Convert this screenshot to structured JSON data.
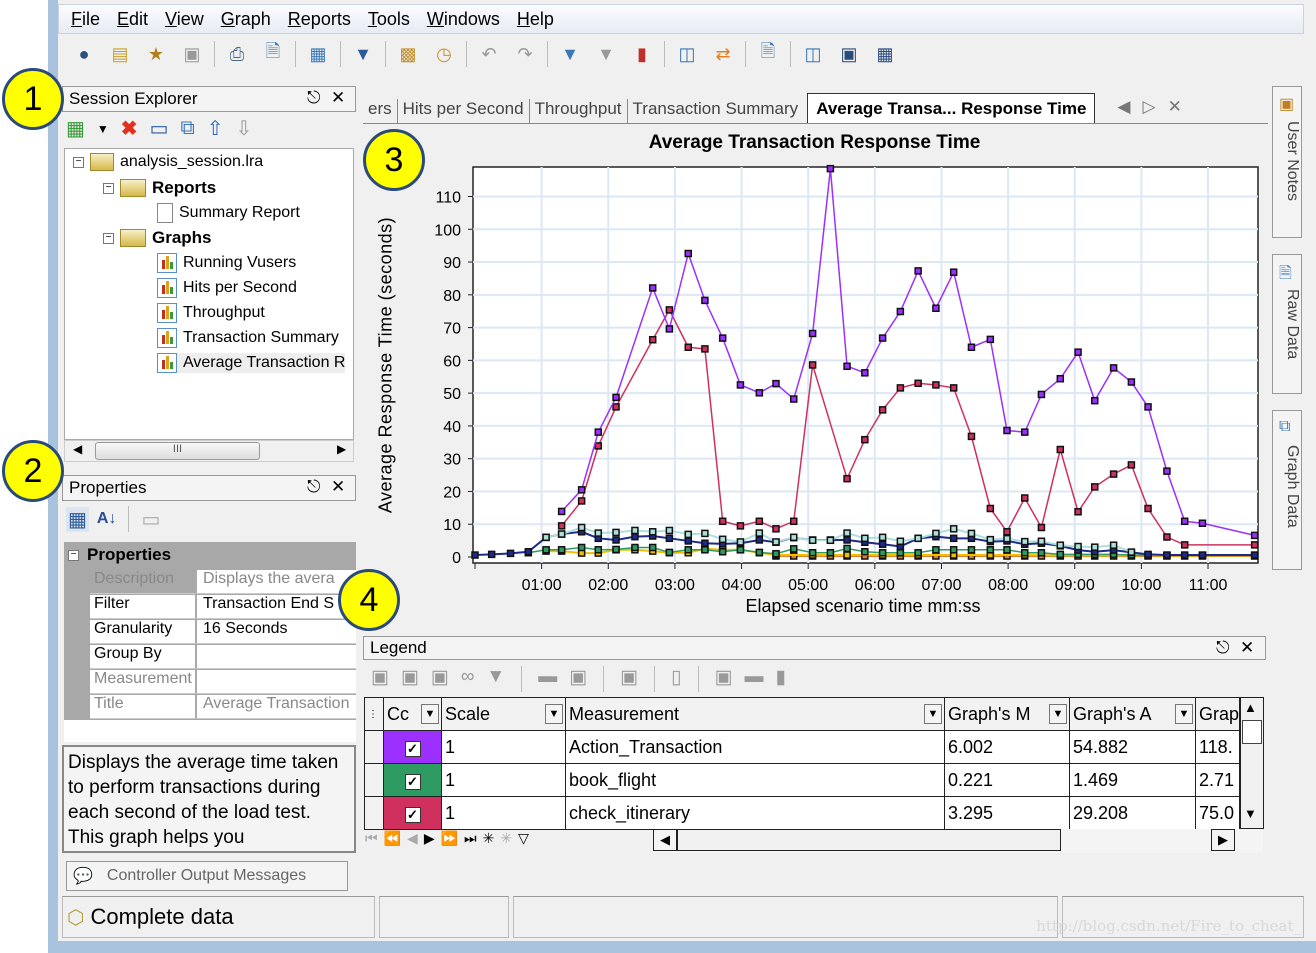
{
  "menu": [
    "File",
    "Edit",
    "View",
    "Graph",
    "Reports",
    "Tools",
    "Windows",
    "Help"
  ],
  "toolbar_icons": [
    "open-session-icon",
    "import-icon",
    "new-session-icon",
    "save-icon",
    "print-icon",
    "export-icon",
    "template-icon",
    "filter-icon",
    "report-icon",
    "schedule-icon",
    "undo-icon",
    "redo-icon",
    "graph-filter-icon",
    "clear-filter-icon",
    "merge-graphs-icon",
    "compare-icon",
    "sync-icon",
    "html-report-icon",
    "properties-icon",
    "zoom-icon",
    "data-icon"
  ],
  "session_explorer": {
    "title": "Session Explorer",
    "tree": {
      "root": "analysis_session.lra",
      "reports_folder": "Reports",
      "summary_report": "Summary Report",
      "graphs_folder": "Graphs",
      "graphs": [
        "Running Vusers",
        "Hits per Second",
        "Throughput",
        "Transaction Summary",
        "Average Transaction R"
      ]
    },
    "scroll_thumb": "III"
  },
  "properties": {
    "title": "Properties",
    "section": "Properties",
    "rows": [
      {
        "key": "Description",
        "value": "Displays the avera"
      },
      {
        "key": "Filter",
        "value": "Transaction End S"
      },
      {
        "key": "Granularity",
        "value": "16 Seconds"
      },
      {
        "key": "Group By",
        "value": ""
      },
      {
        "key": "Measurement",
        "value": ""
      },
      {
        "key": "Title",
        "value": "Average Transaction"
      }
    ],
    "description_text": "Displays the average time taken to perform transactions during each second of the load test. This graph helps you"
  },
  "controller_tab": "Controller Output Messages",
  "status": {
    "text": "Complete data"
  },
  "tabs": [
    "ers",
    "Hits per Second",
    "Throughput",
    "Transaction Summary",
    "Average Transa... Response Time"
  ],
  "side_tabs": [
    "User Notes",
    "Raw Data",
    "Graph Data"
  ],
  "callouts": [
    "1",
    "2",
    "3",
    "4"
  ],
  "watermark": "http://blog.csdn.net/Fire_to_cheat_",
  "legend": {
    "title": "Legend",
    "columns": [
      "Cc",
      "Scale",
      "Measurement",
      "Graph's M",
      "Graph's A",
      "Grap"
    ],
    "rows": [
      {
        "color": "#9b30ff",
        "checked": true,
        "scale": "1",
        "measurement": "Action_Transaction",
        "min": "6.002",
        "avg": "54.882",
        "max": "118."
      },
      {
        "color": "#2e9b62",
        "checked": true,
        "scale": "1",
        "measurement": "book_flight",
        "min": "0.221",
        "avg": "1.469",
        "max": "2.71"
      },
      {
        "color": "#d0305e",
        "checked": true,
        "scale": "1",
        "measurement": "check_itinerary",
        "min": "3.295",
        "avg": "29.208",
        "max": "75.0"
      }
    ]
  },
  "chart_data": {
    "type": "line",
    "title": "Average Transaction Response Time",
    "xlabel": "Elapsed scenario time mm:ss",
    "ylabel": "Average Response Time (seconds)",
    "xlim": [
      "00:00",
      "11:45"
    ],
    "ylim": [
      0,
      119
    ],
    "grid": true,
    "x_ticks": [
      "01:00",
      "02:00",
      "03:00",
      "04:00",
      "05:00",
      "06:00",
      "07:00",
      "08:00",
      "09:00",
      "10:00",
      "11:00"
    ],
    "y_ticks": [
      0,
      10,
      20,
      30,
      40,
      50,
      60,
      70,
      80,
      90,
      100,
      110
    ],
    "series": [
      {
        "name": "Action_Transaction",
        "color": "#9b30ff",
        "points": [
          [
            "01:18",
            13.9
          ],
          [
            "01:36",
            20.5
          ],
          [
            "01:51",
            38.1
          ],
          [
            "02:07",
            48.7
          ],
          [
            "02:40",
            82.1
          ],
          [
            "02:55",
            69.6
          ],
          [
            "03:12",
            92.6
          ],
          [
            "03:27",
            78.3
          ],
          [
            "03:43",
            66.8
          ],
          [
            "03:59",
            52.5
          ],
          [
            "04:16",
            50.1
          ],
          [
            "04:31",
            52.9
          ],
          [
            "04:47",
            48.2
          ],
          [
            "05:04",
            68.2
          ],
          [
            "05:20",
            118.5
          ],
          [
            "05:35",
            58.2
          ],
          [
            "05:51",
            56.2
          ],
          [
            "06:07",
            66.8
          ],
          [
            "06:23",
            74.9
          ],
          [
            "06:39",
            87.3
          ],
          [
            "06:55",
            75.9
          ],
          [
            "07:11",
            86.9
          ],
          [
            "07:27",
            64.0
          ],
          [
            "07:44",
            66.4
          ],
          [
            "07:59",
            38.6
          ],
          [
            "08:15",
            38.1
          ],
          [
            "08:30",
            49.6
          ],
          [
            "08:47",
            54.4
          ],
          [
            "09:03",
            62.5
          ],
          [
            "09:18",
            47.7
          ],
          [
            "09:35",
            57.7
          ],
          [
            "09:51",
            53.4
          ],
          [
            "10:06",
            45.8
          ],
          [
            "10:23",
            26.2
          ],
          [
            "10:39",
            10.9
          ],
          [
            "10:55",
            10.3
          ],
          [
            "11:42",
            6.6
          ]
        ]
      },
      {
        "name": "check_itinerary",
        "color": "#d0305e",
        "points": [
          [
            "01:18",
            9.5
          ],
          [
            "01:36",
            17.1
          ],
          [
            "01:51",
            33.9
          ],
          [
            "02:07",
            45.8
          ],
          [
            "02:40",
            66.3
          ],
          [
            "02:55",
            75.4
          ],
          [
            "03:12",
            64.0
          ],
          [
            "03:27",
            63.5
          ],
          [
            "03:43",
            10.9
          ],
          [
            "03:59",
            9.5
          ],
          [
            "04:16",
            10.9
          ],
          [
            "04:31",
            8.6
          ],
          [
            "04:47",
            10.9
          ],
          [
            "05:04",
            58.6
          ],
          [
            "05:35",
            23.9
          ],
          [
            "05:51",
            35.8
          ],
          [
            "06:07",
            44.9
          ],
          [
            "06:23",
            51.6
          ],
          [
            "06:39",
            53.0
          ],
          [
            "06:55",
            52.5
          ],
          [
            "07:11",
            51.6
          ],
          [
            "07:27",
            36.8
          ],
          [
            "07:44",
            14.8
          ],
          [
            "07:59",
            7.7
          ],
          [
            "08:15",
            18.0
          ],
          [
            "08:30",
            9.0
          ],
          [
            "08:47",
            32.8
          ],
          [
            "09:03",
            13.8
          ],
          [
            "09:18",
            21.4
          ],
          [
            "09:35",
            25.3
          ],
          [
            "09:51",
            28.1
          ],
          [
            "10:06",
            14.8
          ],
          [
            "10:23",
            6.1
          ],
          [
            "10:39",
            3.7
          ],
          [
            "11:42",
            3.7
          ]
        ]
      },
      {
        "color": "#aee0da",
        "points": [
          [
            "01:04",
            6.0
          ],
          [
            "01:18",
            7.0
          ],
          [
            "01:36",
            9.0
          ],
          [
            "01:51",
            7.3
          ],
          [
            "02:07",
            7.5
          ],
          [
            "02:24",
            8.1
          ],
          [
            "02:40",
            7.7
          ],
          [
            "02:55",
            8.1
          ],
          [
            "03:12",
            6.9
          ],
          [
            "03:27",
            7.2
          ],
          [
            "03:43",
            5.4
          ],
          [
            "03:59",
            4.6
          ],
          [
            "04:16",
            7.3
          ],
          [
            "04:31",
            4.6
          ],
          [
            "04:47",
            6.0
          ],
          [
            "05:04",
            5.1
          ],
          [
            "05:20",
            5.1
          ],
          [
            "05:35",
            7.3
          ],
          [
            "05:51",
            5.7
          ],
          [
            "06:07",
            6.0
          ],
          [
            "06:23",
            4.8
          ],
          [
            "06:39",
            5.7
          ],
          [
            "06:55",
            7.2
          ],
          [
            "07:11",
            8.6
          ],
          [
            "07:27",
            7.2
          ],
          [
            "07:44",
            5.3
          ],
          [
            "07:59",
            5.6
          ],
          [
            "08:15",
            4.7
          ],
          [
            "08:30",
            4.8
          ],
          [
            "08:47",
            3.6
          ],
          [
            "09:03",
            3.2
          ],
          [
            "09:18",
            3.0
          ],
          [
            "09:35",
            3.6
          ],
          [
            "09:51",
            1.5
          ]
        ]
      },
      {
        "color": "#1c2a8c",
        "points": [
          [
            "00:00",
            0.6
          ],
          [
            "00:15",
            0.8
          ],
          [
            "00:32",
            1.1
          ],
          [
            "00:48",
            1.6
          ],
          [
            "01:04",
            6.0
          ],
          [
            "01:18",
            7.0
          ],
          [
            "01:36",
            7.7
          ],
          [
            "01:51",
            5.7
          ],
          [
            "02:07",
            5.2
          ],
          [
            "02:24",
            6.2
          ],
          [
            "02:40",
            6.4
          ],
          [
            "02:55",
            5.7
          ],
          [
            "03:12",
            4.9
          ],
          [
            "03:27",
            4.2
          ],
          [
            "03:43",
            4.0
          ],
          [
            "03:59",
            4.2
          ],
          [
            "04:16",
            5.2
          ],
          [
            "04:31",
            4.5
          ],
          [
            "04:47",
            5.9
          ],
          [
            "05:04",
            5.2
          ],
          [
            "05:20",
            5.2
          ],
          [
            "05:35",
            5.2
          ],
          [
            "05:51",
            4.5
          ],
          [
            "06:07",
            3.9
          ],
          [
            "06:23",
            3.2
          ],
          [
            "06:39",
            5.7
          ],
          [
            "06:55",
            6.2
          ],
          [
            "07:11",
            5.7
          ],
          [
            "07:27",
            5.7
          ],
          [
            "07:44",
            4.7
          ],
          [
            "07:59",
            4.9
          ],
          [
            "08:15",
            3.9
          ],
          [
            "08:30",
            4.2
          ],
          [
            "08:47",
            3.4
          ],
          [
            "09:03",
            2.1
          ],
          [
            "09:18",
            1.6
          ],
          [
            "09:35",
            2.1
          ],
          [
            "09:51",
            1.4
          ],
          [
            "10:06",
            0.8
          ],
          [
            "10:23",
            0.6
          ],
          [
            "10:39",
            0.6
          ],
          [
            "10:55",
            0.6
          ],
          [
            "11:42",
            0.6
          ]
        ]
      },
      {
        "name": "book_flight",
        "color": "#2e9b62",
        "points": [
          [
            "00:48",
            1.3
          ],
          [
            "01:04",
            2.2
          ],
          [
            "01:18",
            2.2
          ],
          [
            "01:36",
            2.9
          ],
          [
            "01:51",
            2.2
          ],
          [
            "02:07",
            2.3
          ],
          [
            "02:24",
            2.9
          ],
          [
            "02:40",
            2.9
          ],
          [
            "02:55",
            1.4
          ],
          [
            "03:12",
            2.2
          ],
          [
            "03:27",
            2.2
          ],
          [
            "03:43",
            1.6
          ],
          [
            "03:59",
            2.2
          ],
          [
            "04:16",
            1.4
          ],
          [
            "04:31",
            1.0
          ],
          [
            "04:47",
            2.5
          ],
          [
            "05:04",
            1.3
          ],
          [
            "05:20",
            1.3
          ],
          [
            "05:35",
            2.6
          ],
          [
            "05:51",
            1.6
          ],
          [
            "06:07",
            1.3
          ],
          [
            "06:23",
            1.3
          ],
          [
            "06:39",
            1.3
          ],
          [
            "06:55",
            2.2
          ],
          [
            "07:11",
            2.2
          ],
          [
            "07:27",
            2.2
          ],
          [
            "07:44",
            2.2
          ],
          [
            "07:59",
            2.2
          ],
          [
            "08:15",
            1.3
          ],
          [
            "08:30",
            1.3
          ],
          [
            "08:47",
            0.8
          ],
          [
            "09:03",
            0.8
          ],
          [
            "09:18",
            0.8
          ],
          [
            "09:35",
            0.8
          ],
          [
            "09:51",
            0.6
          ],
          [
            "10:06",
            0.5
          ]
        ]
      },
      {
        "color": "#f0c000",
        "points": [
          [
            "01:04",
            1.8
          ],
          [
            "01:18",
            1.8
          ],
          [
            "01:36",
            1.2
          ],
          [
            "01:51",
            1.2
          ],
          [
            "02:07",
            2.2
          ],
          [
            "02:24",
            2.2
          ],
          [
            "02:40",
            1.8
          ],
          [
            "02:55",
            1.3
          ],
          [
            "03:12",
            1.3
          ],
          [
            "03:27",
            2.5
          ],
          [
            "03:43",
            2.2
          ],
          [
            "03:59",
            2.2
          ],
          [
            "04:16",
            1.3
          ],
          [
            "04:31",
            0.6
          ],
          [
            "05:04",
            0.6
          ],
          [
            "05:35",
            0.6
          ],
          [
            "06:07",
            0.6
          ],
          [
            "06:39",
            0.6
          ],
          [
            "07:11",
            0.6
          ],
          [
            "07:44",
            0.6
          ],
          [
            "08:15",
            0.6
          ],
          [
            "08:47",
            0.5
          ],
          [
            "09:18",
            0.5
          ],
          [
            "09:51",
            0.5
          ],
          [
            "10:23",
            0.5
          ],
          [
            "10:55",
            0.5
          ],
          [
            "11:42",
            0.5
          ]
        ]
      },
      {
        "color": "#e0802a",
        "points": [
          [
            "04:31",
            0.3
          ],
          [
            "04:47",
            0.3
          ],
          [
            "05:04",
            0.3
          ],
          [
            "05:20",
            0.3
          ],
          [
            "05:35",
            0.3
          ],
          [
            "05:51",
            0.3
          ],
          [
            "06:07",
            0.3
          ],
          [
            "06:23",
            0.3
          ],
          [
            "06:39",
            0.3
          ],
          [
            "06:55",
            0.3
          ],
          [
            "07:11",
            0.3
          ],
          [
            "07:27",
            0.3
          ],
          [
            "07:44",
            0.3
          ],
          [
            "07:59",
            0.3
          ],
          [
            "08:15",
            0.3
          ],
          [
            "08:30",
            0.3
          ],
          [
            "08:47",
            0.3
          ],
          [
            "09:03",
            0.3
          ],
          [
            "09:18",
            0.3
          ],
          [
            "09:35",
            0.3
          ],
          [
            "09:51",
            0.3
          ],
          [
            "10:06",
            0.3
          ],
          [
            "10:23",
            0.3
          ],
          [
            "10:39",
            0.3
          ],
          [
            "10:55",
            0.3
          ],
          [
            "11:42",
            0.3
          ]
        ]
      }
    ]
  }
}
